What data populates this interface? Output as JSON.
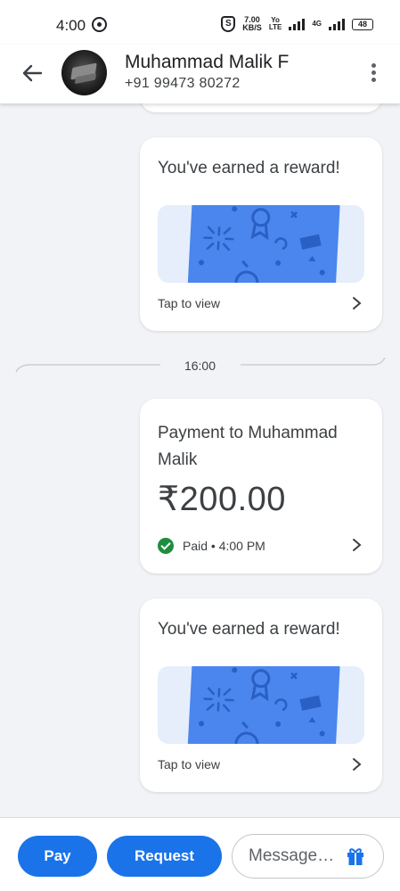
{
  "status_bar": {
    "time": "4:00",
    "speed_value": "7.00",
    "speed_unit": "KB/S",
    "volte_top": "Yo",
    "volte_bottom": "LTE",
    "network": "4G",
    "battery": "48"
  },
  "header": {
    "contact_name": "Muhammad Malik F",
    "contact_phone": "+91 99473 80272"
  },
  "messages": {
    "reward_1": {
      "title": "You've earned a reward!",
      "action": "Tap to view"
    },
    "time_separator": "16:00",
    "payment": {
      "title": "Payment to Muhammad Malik",
      "amount": "₹200.00",
      "status": "Paid • 4:00 PM",
      "status_color": "#1e8e3e"
    },
    "reward_2": {
      "title": "You've earned a reward!",
      "action": "Tap to view"
    }
  },
  "bottom_bar": {
    "pay_label": "Pay",
    "request_label": "Request",
    "message_placeholder": "Message…"
  },
  "colors": {
    "accent": "#1a73e8",
    "reward_ticket": "#4a86ee",
    "reward_bg": "#e6eefc",
    "chat_bg": "#f2f3f6"
  }
}
